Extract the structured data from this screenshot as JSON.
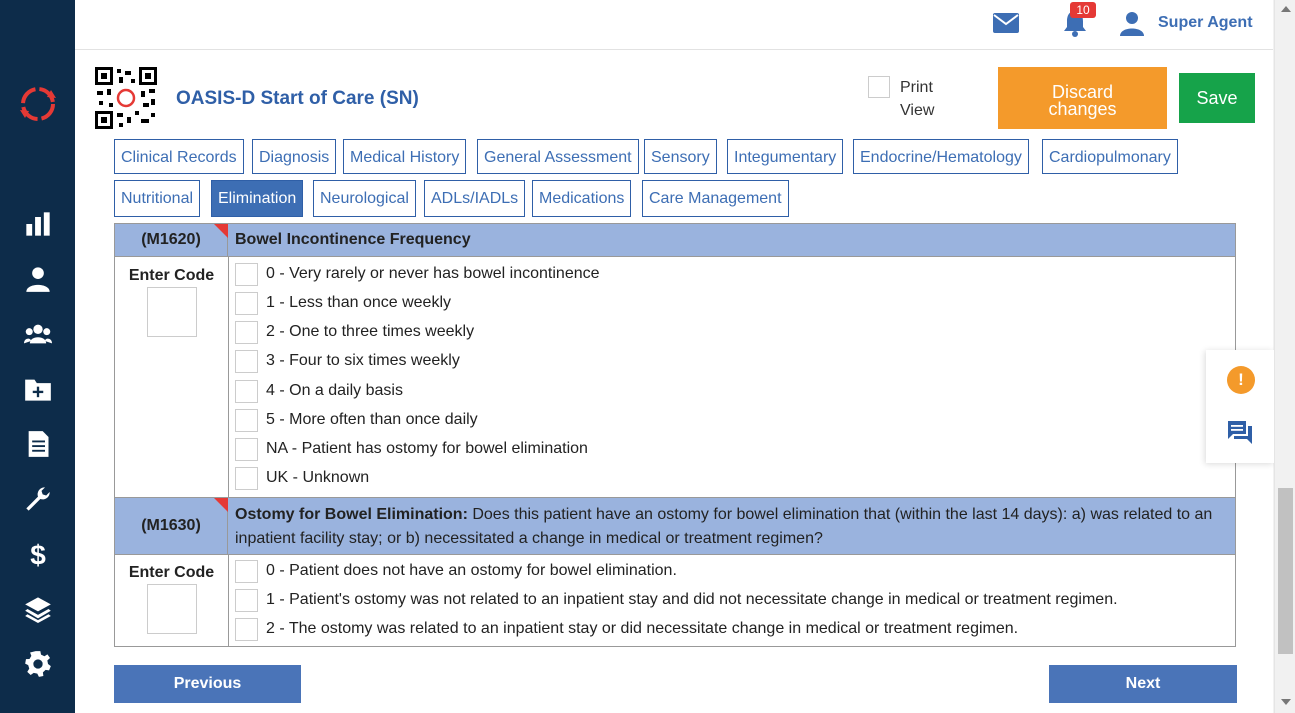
{
  "topbar": {
    "notification_count": "10",
    "user_name": "Super Agent"
  },
  "header": {
    "form_title": "OASIS-D Start of Care (SN)",
    "print_view_label": "Print View",
    "discard_label_line1": "Discard",
    "discard_label_line2": "changes",
    "save_label": "Save"
  },
  "tabs": [
    "Clinical Records",
    "Diagnosis",
    "Medical History",
    "General Assessment",
    "Sensory",
    "Integumentary",
    "Endocrine/Hematology",
    "Cardiopulmonary",
    "Nutritional",
    "Elimination",
    "Neurological",
    "ADLs/IADLs",
    "Medications",
    "Care Management"
  ],
  "active_tab": "Elimination",
  "questions": [
    {
      "code": "(M1620)",
      "title_bold": "Bowel Incontinence Frequency",
      "title_rest": "",
      "enter_code_label": "Enter Code",
      "options": [
        "0 - Very rarely or never has bowel incontinence",
        "1 - Less than once weekly",
        "2 - One to three times weekly",
        "3 - Four to six times weekly",
        "4 - On a daily basis",
        "5 - More often than once daily",
        "NA - Patient has ostomy for bowel elimination",
        "UK - Unknown"
      ]
    },
    {
      "code": "(M1630)",
      "title_bold": "Ostomy for Bowel Elimination:",
      "title_rest": " Does this patient have an ostomy for bowel elimination that (within the last 14 days): a) was related to an inpatient facility stay; or b) necessitated a change in medical or treatment regimen?",
      "enter_code_label": "Enter Code",
      "options": [
        "0 - Patient does not have an ostomy for bowel elimination.",
        "1 - Patient's ostomy was not related to an inpatient stay and did not necessitate change in medical or treatment regimen.",
        "2 - The ostomy was related to an inpatient stay or did necessitate change in medical or treatment regimen."
      ]
    }
  ],
  "navigation": {
    "previous_label": "Previous",
    "next_label": "Next"
  },
  "colors": {
    "sidebar": "#0d2c4a",
    "accent_blue": "#3d6eb4",
    "question_header": "#9ab3de",
    "discard": "#f49a2b",
    "save": "#16a34a"
  }
}
